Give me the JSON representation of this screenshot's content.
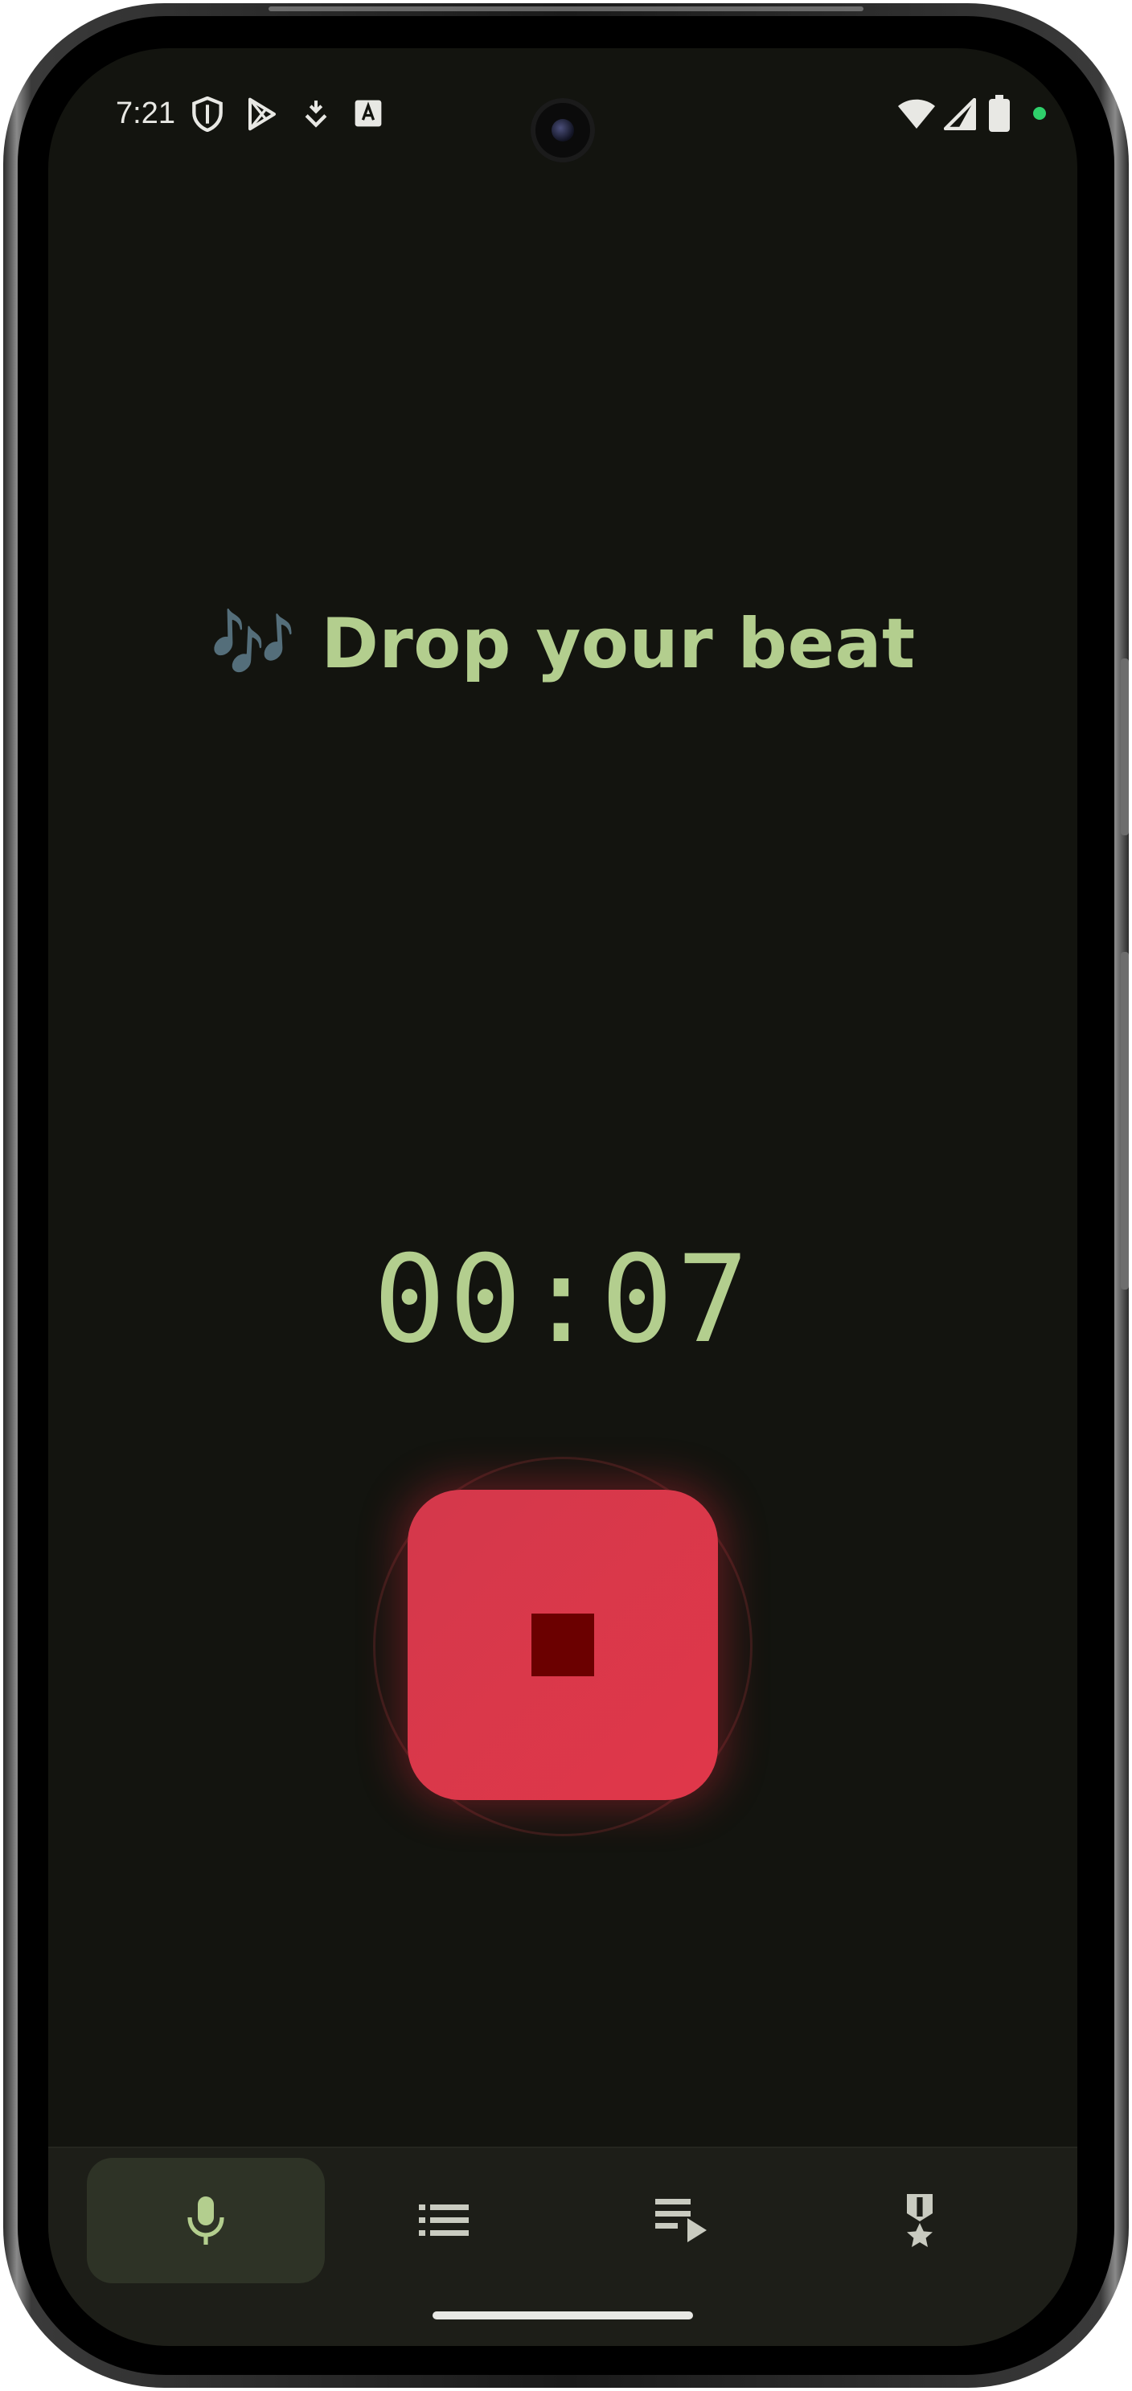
{
  "status_bar": {
    "time": "7:21",
    "left_icons": [
      "shield-icon",
      "play-store-icon",
      "download-icon",
      "font-icon"
    ],
    "right_icons": [
      "wifi-icon",
      "signal-icon",
      "battery-icon",
      "privacy-dot-icon"
    ]
  },
  "main": {
    "title_emoji": "🎶",
    "title": "Drop your beat",
    "timer": "00:07",
    "record_button_state": "recording",
    "record_button_icon": "stop-icon"
  },
  "bottom_nav": {
    "items": [
      {
        "icon": "mic-icon",
        "active": true
      },
      {
        "icon": "list-icon",
        "active": false
      },
      {
        "icon": "playlist-play-icon",
        "active": false
      },
      {
        "icon": "medal-icon",
        "active": false
      }
    ]
  },
  "colors": {
    "background": "#13140f",
    "accent": "#b3ce8e",
    "record": "#dc3548",
    "stop": "#6b0000",
    "nav_background": "#1d1e18",
    "nav_active": "#2e3326"
  }
}
